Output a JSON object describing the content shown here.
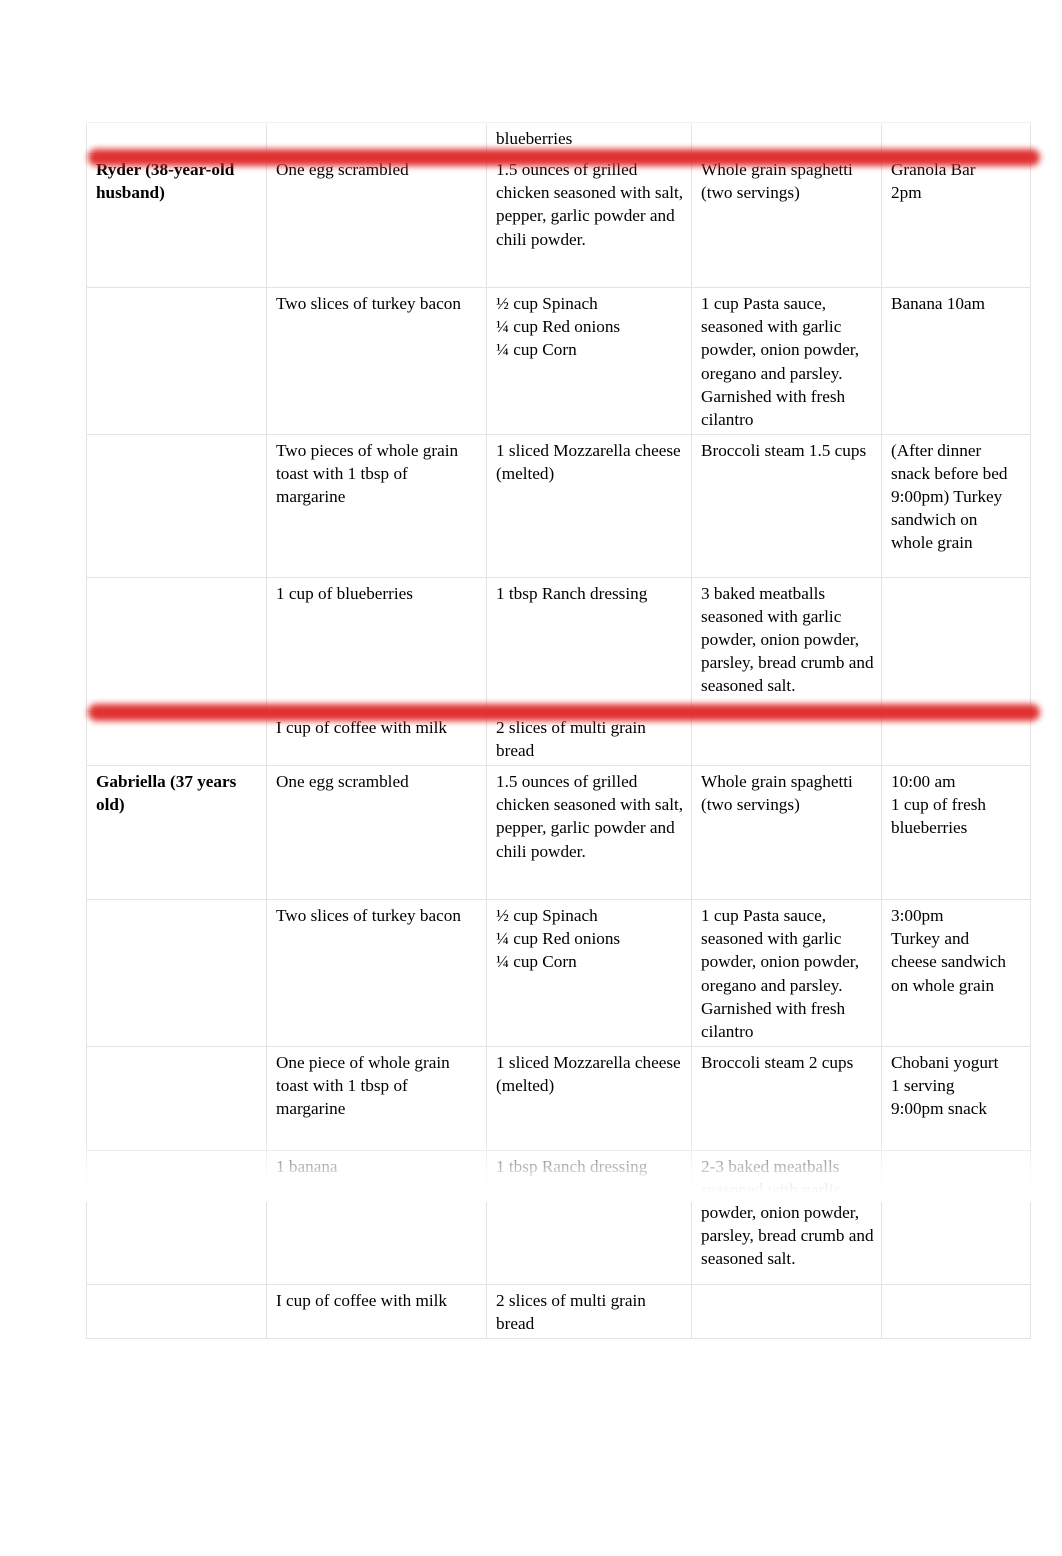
{
  "document": {
    "type": "meal-plan-table",
    "accent_color": "#e02b2b",
    "border_color": "#e3e3e3",
    "text_color": "#000000",
    "background_color": "#ffffff"
  },
  "columns": {
    "person": "",
    "breakfast": "",
    "lunch": "",
    "dinner": "",
    "snacks": ""
  },
  "continuation_row": {
    "person": "",
    "breakfast": "",
    "lunch": "blueberries",
    "dinner": "",
    "snacks": ""
  },
  "sections": [
    {
      "id": "ryder",
      "person": "Ryder (38-year-old husband)",
      "rows": [
        {
          "person": "Ryder (38-year-old husband)",
          "breakfast": "One egg scrambled",
          "lunch": "1.5 ounces of grilled chicken seasoned with salt, pepper, garlic powder and chili powder.",
          "dinner": "Whole grain spaghetti (two servings)",
          "snacks": "Granola Bar\n2pm"
        },
        {
          "person": "",
          "breakfast": "Two slices of turkey bacon",
          "lunch": "½ cup Spinach\n¼ cup Red onions\n¼ cup Corn",
          "dinner": "1 cup Pasta sauce, seasoned with garlic powder, onion powder, oregano and parsley. Garnished with fresh cilantro",
          "snacks": "Banana 10am"
        },
        {
          "person": "",
          "breakfast": "Two pieces of whole grain toast with 1 tbsp of margarine",
          "lunch": "1 sliced Mozzarella cheese (melted)",
          "dinner": "Broccoli steam 1.5 cups",
          "snacks": "(After dinner snack before bed 9:00pm) Turkey sandwich on whole grain"
        },
        {
          "person": "",
          "breakfast": "1 cup of blueberries",
          "lunch": "1 tbsp Ranch dressing",
          "dinner": "3 baked meatballs seasoned with garlic powder, onion powder, parsley, bread crumb and seasoned salt.",
          "snacks": ""
        },
        {
          "person": "",
          "breakfast": "I cup of coffee with milk",
          "lunch": "2 slices of multi grain bread",
          "dinner": "",
          "snacks": ""
        }
      ]
    },
    {
      "id": "gabriella",
      "person": "Gabriella (37 years old)",
      "rows": [
        {
          "person": "Gabriella (37 years old)",
          "breakfast": "One egg scrambled",
          "lunch": "1.5 ounces of grilled chicken seasoned with salt, pepper, garlic powder and chili powder.",
          "dinner": "Whole grain spaghetti (two servings)",
          "snacks": "10:00 am\n1 cup of fresh blueberries"
        },
        {
          "person": "",
          "breakfast": "Two slices of turkey bacon",
          "lunch": "½ cup Spinach\n¼ cup Red onions\n¼ cup Corn",
          "dinner": "1 cup Pasta sauce, seasoned with garlic powder, onion powder, oregano and parsley. Garnished with fresh cilantro",
          "snacks": "3:00pm\nTurkey and cheese sandwich on whole grain"
        },
        {
          "person": "",
          "breakfast": "One piece of whole grain toast with 1 tbsp of margarine",
          "lunch": "1 sliced Mozzarella cheese (melted)",
          "dinner": "Broccoli steam 2 cups",
          "snacks": "Chobani yogurt\n1 serving\n9:00pm snack"
        },
        {
          "person": "",
          "breakfast": "1 banana",
          "lunch": "1 tbsp Ranch dressing",
          "dinner": "2-3 baked meatballs seasoned with garlic powder, onion powder, parsley, bread crumb and seasoned salt.",
          "snacks": ""
        },
        {
          "person": "",
          "breakfast": "I cup of coffee with milk",
          "lunch": "2 slices of multi grain bread",
          "dinner": "",
          "snacks": ""
        }
      ]
    }
  ],
  "lunch_portion_lines": {
    "spinach": "½ cup Spinach",
    "red_onions": "¼ cup Red onions",
    "corn": "¼ cup Corn"
  },
  "snack_lines": {
    "ryder_r1_a": "Granola Bar",
    "ryder_r1_b": "2pm",
    "gabriella_r1_a": "10:00 am",
    "gabriella_r1_b": "1 cup of fresh",
    "gabriella_r1_c": "blueberries",
    "gabriella_r2_a": "3:00pm",
    "gabriella_r2_b": "Turkey and",
    "gabriella_r2_c": "cheese sandwich",
    "gabriella_r2_d": "on whole grain",
    "gabriella_r3_a": "Chobani yogurt",
    "gabriella_r3_b": "1 serving",
    "gabriella_r3_c": "9:00pm snack"
  }
}
